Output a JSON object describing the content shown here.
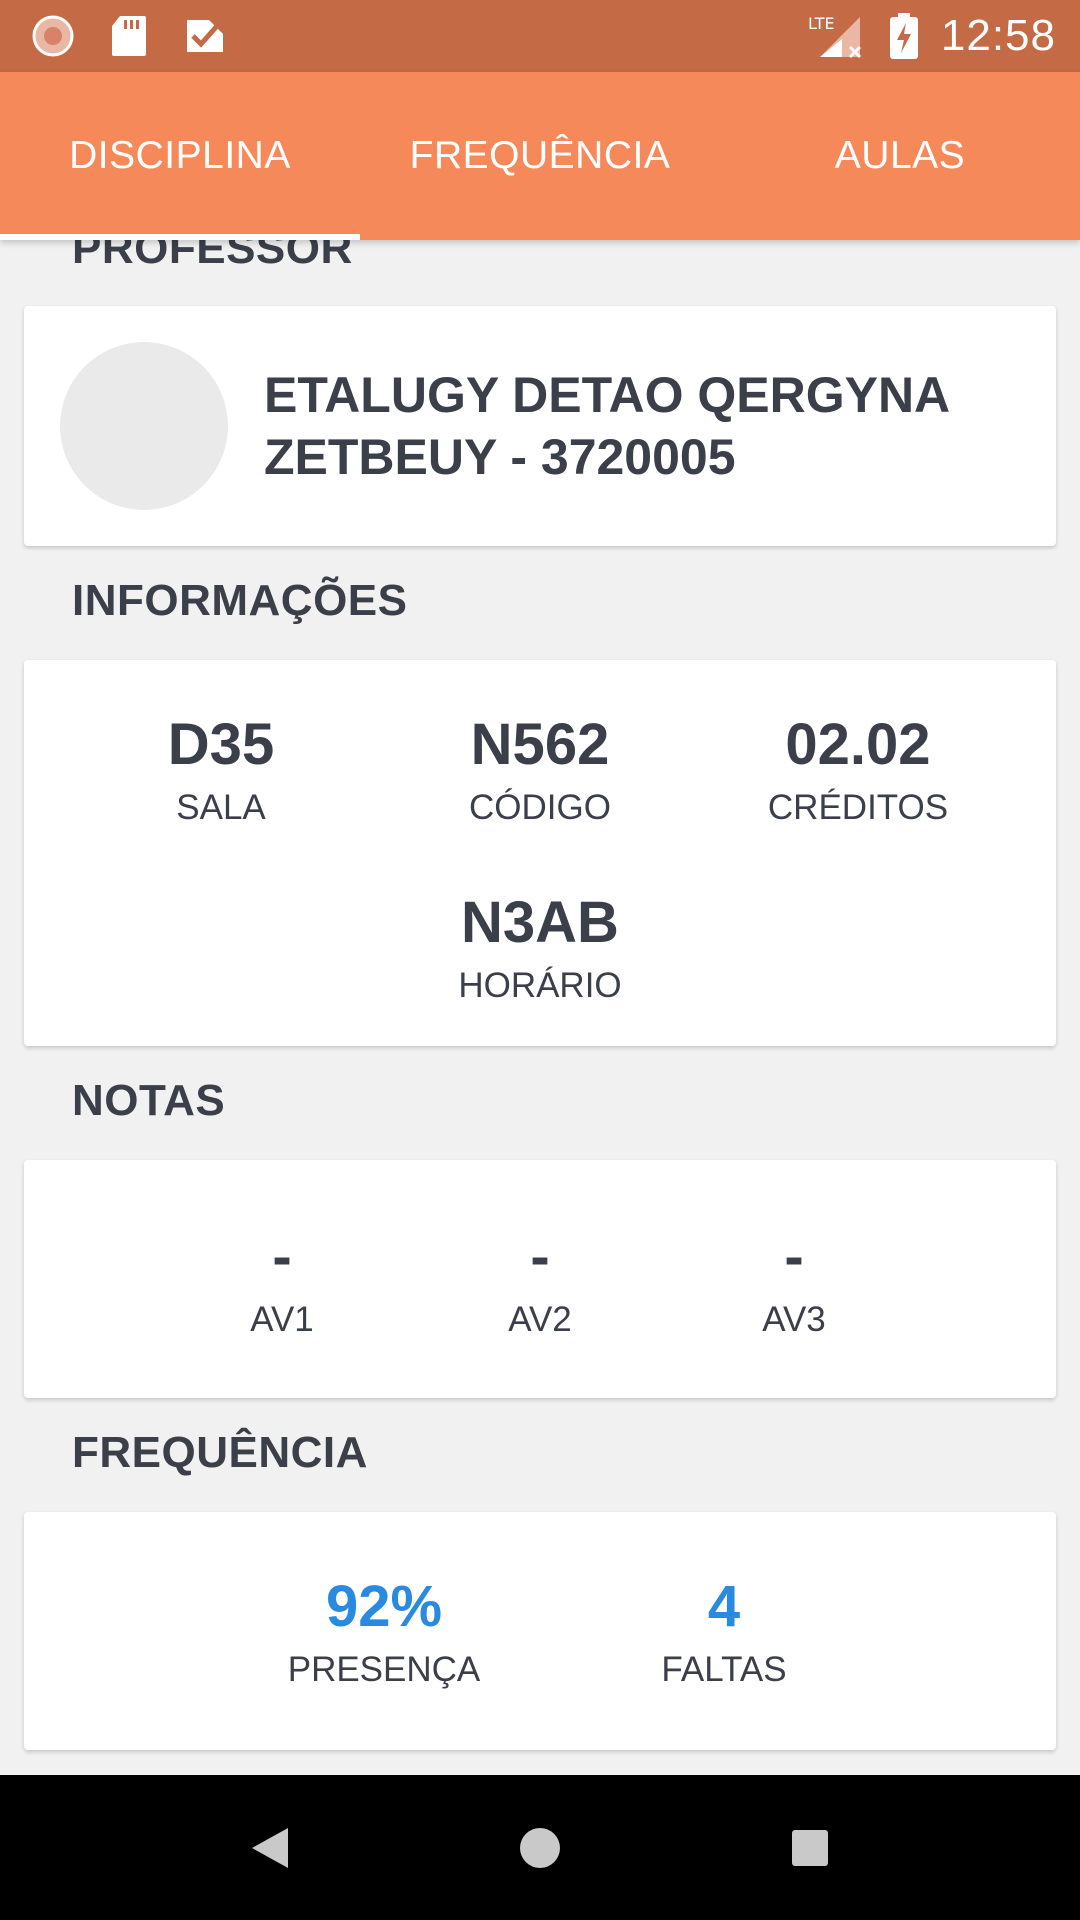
{
  "status_bar": {
    "time": "12:58",
    "network": "LTE",
    "icons": [
      "app-icon",
      "sd-card-icon",
      "check-icon",
      "signal-icon",
      "battery-charging-icon"
    ]
  },
  "tabs": [
    {
      "label": "DISCIPLINA",
      "active": true
    },
    {
      "label": "FREQUÊNCIA",
      "active": false
    },
    {
      "label": "AULAS",
      "active": false
    }
  ],
  "professor": {
    "section_title": "PROFESSOR",
    "name": "ETALUGY DETAO QERGYNA ZETBEUY - 3720005"
  },
  "informacoes": {
    "section_title": "INFORMAÇÕES",
    "items": [
      {
        "value": "D35",
        "label": "SALA"
      },
      {
        "value": "N562",
        "label": "CÓDIGO"
      },
      {
        "value": "02.02",
        "label": "CRÉDITOS"
      },
      {
        "value": "N3AB",
        "label": "HORÁRIO"
      }
    ]
  },
  "notas": {
    "section_title": "NOTAS",
    "items": [
      {
        "value": "-",
        "label": "AV1"
      },
      {
        "value": "-",
        "label": "AV2"
      },
      {
        "value": "-",
        "label": "AV3"
      }
    ]
  },
  "frequencia": {
    "section_title": "FREQUÊNCIA",
    "items": [
      {
        "value": "92%",
        "label": "PRESENÇA"
      },
      {
        "value": "4",
        "label": "FALTAS"
      }
    ]
  },
  "colors": {
    "status_bar": "#c46a45",
    "tab_bar": "#f6895a",
    "accent_blue": "#2a8ae0",
    "background": "#f1f1f1"
  }
}
